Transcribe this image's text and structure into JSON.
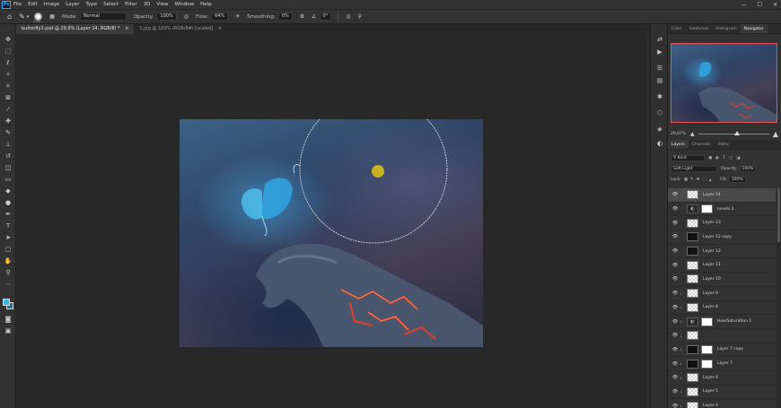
{
  "menubar": {
    "logo": "Ps",
    "items": [
      "File",
      "Edit",
      "Image",
      "Layer",
      "Type",
      "Select",
      "Filter",
      "3D",
      "View",
      "Window",
      "Help"
    ],
    "window_controls": [
      "—",
      "☐",
      "✕"
    ]
  },
  "options_bar": {
    "brush_size": "1000",
    "mode_label": "Mode:",
    "mode_value": "Normal",
    "opacity_label": "Opacity:",
    "opacity_value": "100%",
    "flow_label": "Flow:",
    "flow_value": "64%",
    "smoothing_label": "Smoothing:",
    "smoothing_value": "0%",
    "angle_value": "0°"
  },
  "tabs": [
    {
      "label": "butterfly2.psd @ 29,9% (Layer 14, RGB/8) *",
      "close": "×",
      "active": true
    },
    {
      "label": "1.jpg @ 100% (RGB/8#) [scaled]",
      "close": "×",
      "active": false
    }
  ],
  "panels": {
    "top_tabs": [
      "Color",
      "Swatches",
      "Histogram",
      "Navigator"
    ],
    "zoom": "29,87%",
    "zoom_level": 0.55,
    "layers_tabs": [
      "Layers",
      "Channels",
      "Paths"
    ],
    "kind_label": "Kind",
    "blend_mode": "Soft Light",
    "opacity_label": "Opacity:",
    "opacity_value": "100%",
    "lock_label": "Lock:",
    "fill_label": "Fill:",
    "fill_value": "100%",
    "layers": [
      {
        "name": "Layer 14",
        "thumb": "transparent",
        "selected": true
      },
      {
        "name": "Levels 3",
        "thumb": "adjustment",
        "mask": true
      },
      {
        "name": "Layer 13",
        "thumb": "transparent"
      },
      {
        "name": "Layer 12 copy",
        "thumb": "dark"
      },
      {
        "name": "Layer 12",
        "thumb": "dark"
      },
      {
        "name": "Layer 11",
        "thumb": "transparent"
      },
      {
        "name": "Layer 10",
        "thumb": "transparent"
      },
      {
        "name": "Layer 9",
        "thumb": "transparent"
      },
      {
        "name": "Layer 8",
        "thumb": "transparent"
      },
      {
        "name": "Hue/Saturation 1",
        "thumb": "adjustment",
        "mask": true
      },
      {
        "name": "",
        "thumb": "transparent"
      },
      {
        "name": "Layer 7 copy",
        "thumb": "dark",
        "mask": true
      },
      {
        "name": "Layer 7",
        "thumb": "dark",
        "mask": true
      },
      {
        "name": "Layer 6",
        "thumb": "transparent"
      },
      {
        "name": "Layer 5",
        "thumb": "transparent"
      },
      {
        "name": "Layer 4",
        "thumb": "transparent"
      }
    ]
  },
  "colors": {
    "foreground": "#35b7e8",
    "background": "#1c6f96",
    "navigator_frame": "#e55252",
    "brush_cursor": "#c8b222"
  }
}
